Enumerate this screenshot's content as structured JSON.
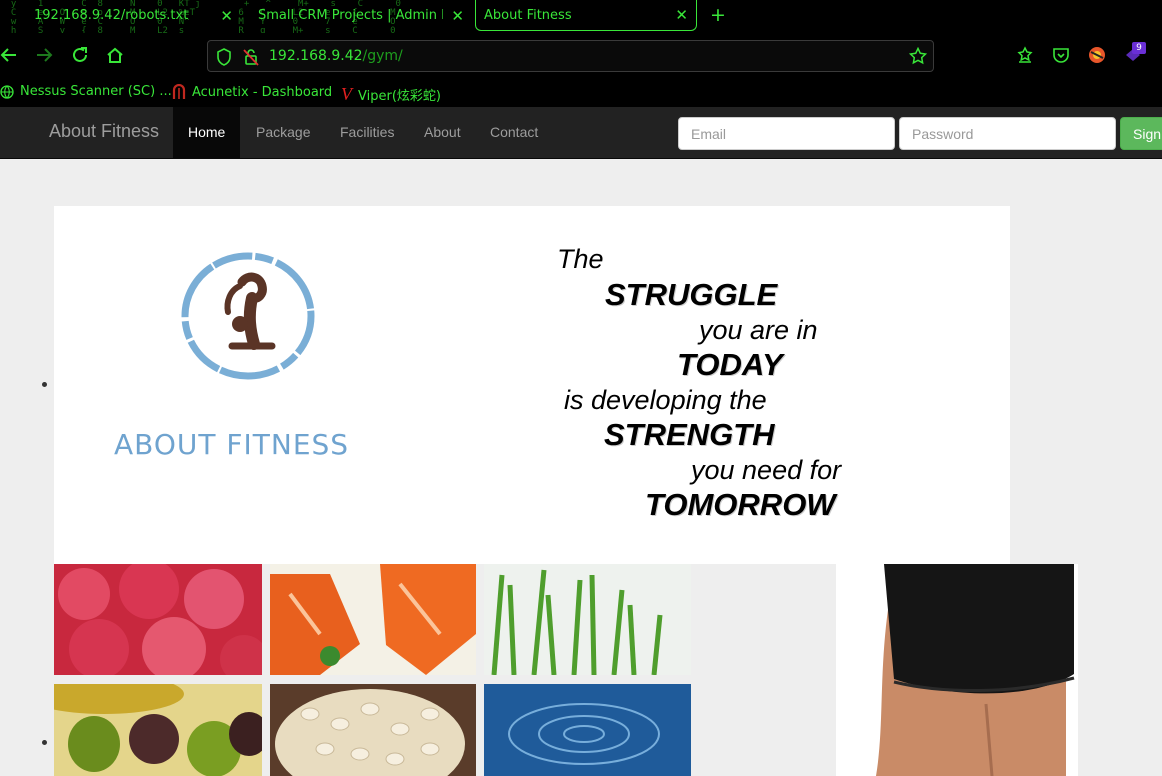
{
  "browser": {
    "tabs": [
      {
        "title": "192.168.9.42/robots.txt",
        "active": false
      },
      {
        "title": "Small CRM Projects | Admin Lo",
        "active": false
      },
      {
        "title": "About Fitness",
        "active": true
      }
    ],
    "url_host": "192.168.9.42",
    "url_path": "/gym/",
    "extension_badge": "9",
    "bookmarks": [
      {
        "label": "Nessus Scanner (SC) ...",
        "icon": "globe-icon"
      },
      {
        "label": "Acunetix - Dashboard",
        "icon": "acunetix-icon"
      },
      {
        "label": "Viper(炫彩蛇)",
        "icon": "viper-icon"
      }
    ],
    "theme_color": "#39e639"
  },
  "site": {
    "brand": "About Fitness",
    "nav": [
      {
        "label": "Home",
        "active": true
      },
      {
        "label": "Package",
        "active": false
      },
      {
        "label": "Facilities",
        "active": false
      },
      {
        "label": "About",
        "active": false
      },
      {
        "label": "Contact",
        "active": false
      }
    ],
    "email_placeholder": "Email",
    "password_placeholder": "Password",
    "sign_in_label": "Sign"
  },
  "banner": {
    "logo_text": "ABOUT FITNESS",
    "quote": {
      "line1": "The",
      "line2": "STRUGGLE",
      "line3": "you are in",
      "line4": "TODAY",
      "line5": "is developing the",
      "line6": "STRENGTH",
      "line7": "you need for",
      "line8": "TOMORROW"
    }
  },
  "gallery": {
    "tiles": [
      "raspberries",
      "salmon",
      "wheatgrass",
      "olives",
      "barley",
      "water",
      "fit-torso"
    ]
  }
}
